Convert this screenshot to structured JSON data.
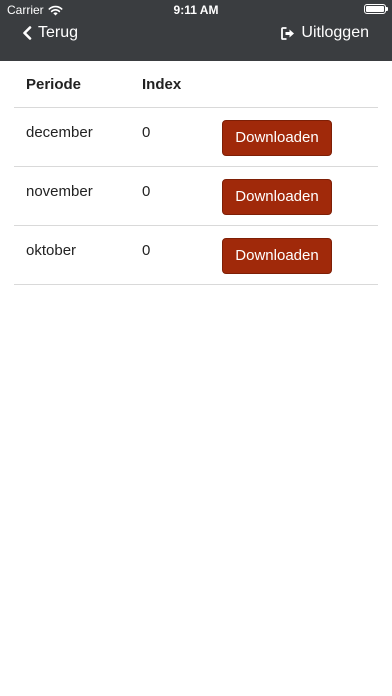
{
  "status_bar": {
    "carrier": "Carrier",
    "time": "9:11 AM"
  },
  "nav": {
    "back_label": "Terug",
    "logout_label": "Uitloggen"
  },
  "table": {
    "headers": {
      "periode": "Periode",
      "index": "Index"
    },
    "rows": [
      {
        "periode": "december",
        "index": "0",
        "button": "Downloaden"
      },
      {
        "periode": "november",
        "index": "0",
        "button": "Downloaden"
      },
      {
        "periode": "oktober",
        "index": "0",
        "button": "Downloaden"
      }
    ]
  },
  "colors": {
    "header_bg": "#3a3d40",
    "button_bg": "#a0290a"
  }
}
